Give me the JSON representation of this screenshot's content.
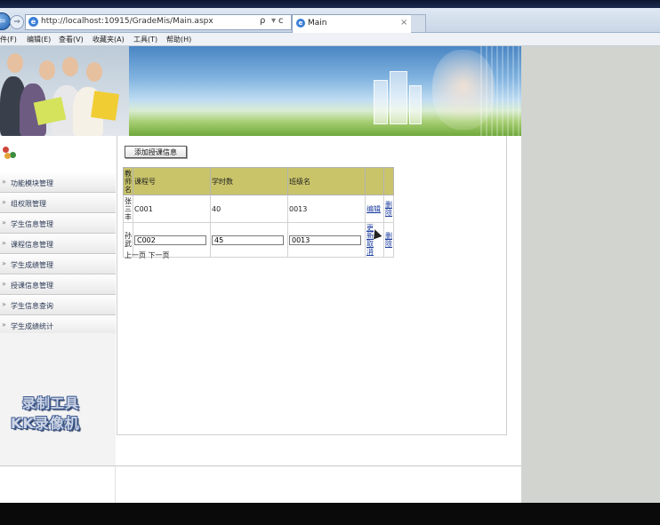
{
  "browser": {
    "address_url": "http://localhost:10915/GradeMis/Main.aspx",
    "search_glyph": "ρ",
    "refresh_glyph": "ᴄ",
    "tab_title": "Main",
    "tab_close": "×",
    "back_glyph": "⇐",
    "forward_glyph": "⇒",
    "menu": [
      "件(F)",
      "编辑(E)",
      "查看(V)",
      "收藏夹(A)",
      "工具(T)",
      "帮助(H)"
    ]
  },
  "sidebar": {
    "items": [
      "功能模块管理",
      "组权限管理",
      "学生信息管理",
      "课程信息管理",
      "学生成绩管理",
      "授课信息管理",
      "学生信息查询",
      "学生成绩统计"
    ],
    "arrow": "»"
  },
  "watermark": {
    "line1": "录制工具",
    "line2": "KK录像机"
  },
  "content": {
    "add_button": "添加授课信息",
    "table": {
      "headers": [
        "教师名",
        "课程号",
        "学时数",
        "班级名",
        "",
        ""
      ],
      "rows": [
        {
          "teacher": "张三丰",
          "course": "C001",
          "hours": "40",
          "class": "0013",
          "action1": "编辑",
          "action2": "删除"
        },
        {
          "teacher": "孙武",
          "course": "C002",
          "hours": "45",
          "class": "0013",
          "action1": "更新",
          "action1b": "取消",
          "action2": "删除"
        }
      ]
    },
    "pager": {
      "prev": "上一页",
      "next": "下一页"
    }
  },
  "colors": {
    "header_bg": "#c9c46a",
    "link": "#1f3f9f",
    "sidebar_text": "#2c3a56"
  }
}
